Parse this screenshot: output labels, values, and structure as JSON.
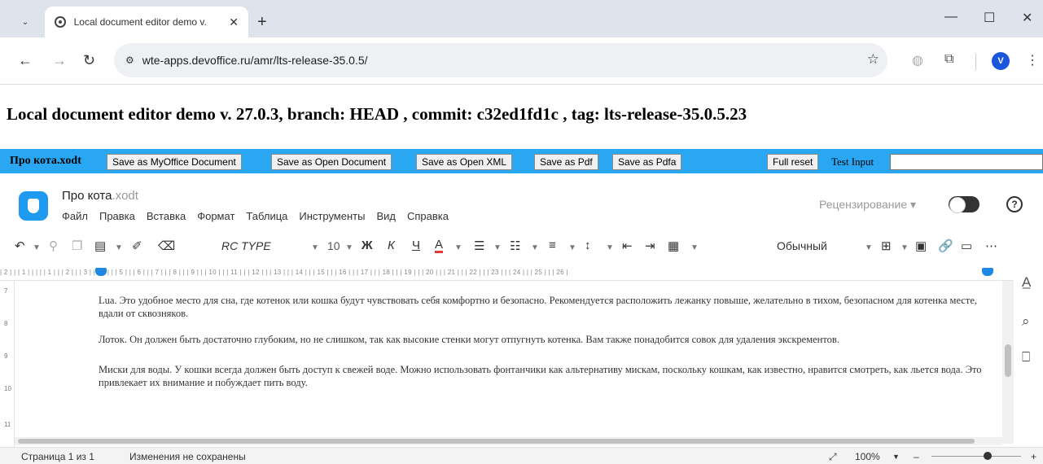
{
  "browser": {
    "tab_title": "Local document editor demo v.",
    "tab_close": "✕",
    "new_tab": "+",
    "url": "wte-apps.devoffice.ru/amr/lts-release-35.0.5/",
    "avatar_letter": "V",
    "window_minimize": "—",
    "window_maximize": "☐",
    "window_close": "✕"
  },
  "page": {
    "heading": "Local document editor demo v. 27.0.3, branch: HEAD , commit: c32ed1fd1c , tag: lts-release-35.0.5.23"
  },
  "demobar": {
    "file_name": "Про кота.xodt",
    "buttons": [
      "Save as MyOffice Document",
      "Save as Open Document",
      "Save as Open XML",
      "Save as Pdf",
      "Save as Pdfa"
    ],
    "full_reset": "Full reset",
    "test_input_label": "Test Input",
    "test_input_value": ""
  },
  "editor": {
    "doc_title": "Про кота",
    "doc_ext": ".xodt",
    "menu": [
      "Файл",
      "Правка",
      "Вставка",
      "Формат",
      "Таблица",
      "Инструменты",
      "Вид",
      "Справка"
    ],
    "review_label": "Рецензирование ▾",
    "help_label": "?"
  },
  "toolbar": {
    "font_name": "RC TYPE",
    "font_size": "10",
    "bold": "Ж",
    "italic": "К",
    "underline": "Ч",
    "font_color": "А",
    "style_name": "Обычный",
    "more": "⋯"
  },
  "ruler": {
    "labels": "| 2 |  |  | 1 |  |  |  |  | 1 |  |  | 2 |  |  | 3 |  |  | 4 |  |  | 5 |  |  | 6 |  |  | 7 |  |  | 8 |  |  | 9 |  |  | 10 |  |  | 11 |  |  | 12 |  |  | 13 |  |  | 14 |  |  | 15 |  |  | 16 |  |  | 17 |  |  | 18 |  |  | 19 |  |  | 20 |  |  | 21 |  |  | 22 |  |  | 23 |  |  | 24 |  |  | 25 |  |  | 26 |",
    "vertical": [
      "7",
      "8",
      "9",
      "10",
      "11"
    ]
  },
  "document": {
    "paragraphs": [
      "Lua. Это удобное место для сна, где котенок или кошка будут чувствовать себя комфортно и безопасно. Рекомендуется расположить лежанку повыше, желательно в тихом, безопасном для котенка месте, вдали от сквозняков.",
      "Лоток. Он должен быть достаточно глубоким, но не слишком, так как высокие стенки могут отпугнуть котенка. Вам также понадобится совок для удаления экскрементов.",
      "Миски для воды. У кошки всегда должен быть доступ к свежей воде. Можно использовать фонтанчики как альтернативу мискам, поскольку кошкам, как известно, нравится смотреть, как льется вода. Это привлекает их внимание и побуждает пить воду."
    ]
  },
  "status": {
    "page": "Страница 1 из 1",
    "save_state": "Изменения не сохранены",
    "zoom": "100%",
    "zoom_minus": "–",
    "zoom_plus": "+"
  }
}
